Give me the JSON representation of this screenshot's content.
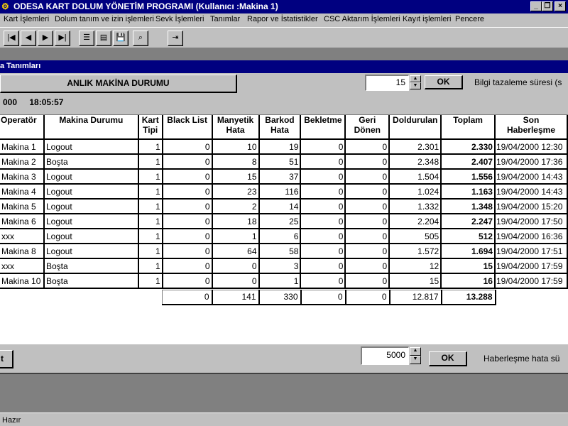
{
  "window": {
    "icon": "app-icon",
    "title": "ODESA KART DOLUM YÖNETİM PROGRAMI (Kullanıcı :Makina 1)",
    "minimize": "_",
    "restore": "❐",
    "close": "×"
  },
  "menu": [
    "Kart İşlemleri",
    "Dolum tanım ve izin işlemleri",
    "Sevk İşlemleri",
    "Tanımlar",
    "Rapor ve İstatistikler",
    "CSC Aktarım İşlemleri",
    "Kayıt işlemleri",
    "Pencere"
  ],
  "toolbar": {
    "buttons": [
      {
        "name": "first-record-icon",
        "glyph": "|◀"
      },
      {
        "name": "previous-record-icon",
        "glyph": "◀"
      },
      {
        "name": "next-record-icon",
        "glyph": "▶"
      },
      {
        "name": "last-record-icon",
        "glyph": "▶|"
      },
      {
        "name": "list-icon",
        "glyph": "☰"
      },
      {
        "name": "form-icon",
        "glyph": "▤"
      },
      {
        "name": "save-disk-icon",
        "glyph": "💾"
      },
      {
        "name": "search-icon",
        "glyph": "⌕"
      },
      {
        "name": "exit-door-icon",
        "glyph": "⇥"
      }
    ]
  },
  "child_window": {
    "title": "a Tanımları"
  },
  "top_controls": {
    "status_button": "ANLIK MAKİNA DURUMU",
    "refresh_value": "15",
    "ok_label": "OK",
    "refresh_label": "Bilgi tazaleme süresi (s"
  },
  "status_line": {
    "date": "000",
    "time": "18:05:57"
  },
  "table": {
    "headers": [
      "Operatör",
      "Makina Durumu",
      "Kart\nTipi",
      "Black List",
      "Manyetik\nHata",
      "Barkod\nHata",
      "Bekletme",
      "Geri\nDönen",
      "Doldurulan",
      "Toplam",
      "Son\nHaberleşme"
    ],
    "rows": [
      [
        "Makina 1",
        "Logout",
        "1",
        "0",
        "10",
        "19",
        "0",
        "0",
        "2.301",
        "2.330",
        "19/04/2000 12:30"
      ],
      [
        "Makina 2",
        "Boşta",
        "1",
        "0",
        "8",
        "51",
        "0",
        "0",
        "2.348",
        "2.407",
        "19/04/2000 17:36"
      ],
      [
        "Makina 3",
        "Logout",
        "1",
        "0",
        "15",
        "37",
        "0",
        "0",
        "1.504",
        "1.556",
        "19/04/2000 14:43"
      ],
      [
        "Makina 4",
        "Logout",
        "1",
        "0",
        "23",
        "116",
        "0",
        "0",
        "1.024",
        "1.163",
        "19/04/2000 14:43"
      ],
      [
        "Makina 5",
        "Logout",
        "1",
        "0",
        "2",
        "14",
        "0",
        "0",
        "1.332",
        "1.348",
        "19/04/2000 15:20"
      ],
      [
        "Makina 6",
        "Logout",
        "1",
        "0",
        "18",
        "25",
        "0",
        "0",
        "2.204",
        "2.247",
        "19/04/2000 17:50"
      ],
      [
        "xxx",
        "Logout",
        "1",
        "0",
        "1",
        "6",
        "0",
        "0",
        "505",
        "512",
        "19/04/2000 16:36"
      ],
      [
        "Makina 8",
        "Logout",
        "1",
        "0",
        "64",
        "58",
        "0",
        "0",
        "1.572",
        "1.694",
        "19/04/2000 17:51"
      ],
      [
        "xxx",
        "Boşta",
        "1",
        "0",
        "0",
        "3",
        "0",
        "0",
        "12",
        "15",
        "19/04/2000 17:59"
      ],
      [
        "Makina 10",
        "Boşta",
        "1",
        "0",
        "0",
        "1",
        "0",
        "0",
        "15",
        "16",
        "19/04/2000 17:59"
      ]
    ],
    "totals": [
      "0",
      "141",
      "330",
      "0",
      "0",
      "12.817",
      "13.288"
    ]
  },
  "bottom_controls": {
    "left_button": "t",
    "comm_value": "5000",
    "ok_label": "OK",
    "comm_label": "Haberleşme hata sü"
  },
  "statusbar": {
    "text": "Hazır"
  }
}
